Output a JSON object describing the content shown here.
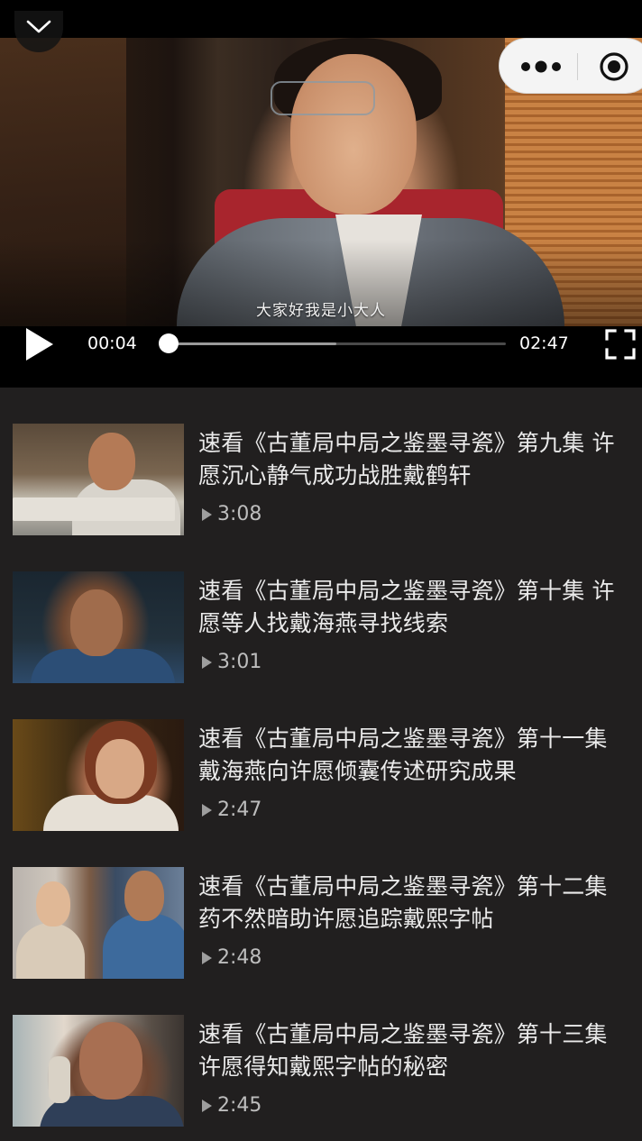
{
  "player": {
    "subtitle": "大家好我是小大人",
    "current_time": "00:04",
    "total_time": "02:47",
    "progress_fraction": 0.024,
    "buffered_fraction": 0.51
  },
  "icons": {
    "collapse": "chevron-down-icon",
    "more": "more-dots-icon",
    "close": "target-circle-icon",
    "play": "play-icon",
    "fullscreen": "fullscreen-icon",
    "duration": "play-triangle-icon"
  },
  "colors": {
    "background": "#211f1f",
    "title_text": "#eaeaea",
    "meta_text": "#bdbdbd",
    "player_bg": "#000000"
  },
  "episodes": [
    {
      "title": "速看《古董局中局之鉴墨寻瓷》第九集 许愿沉心静气成功战胜戴鹤轩",
      "duration": "3:08"
    },
    {
      "title": "速看《古董局中局之鉴墨寻瓷》第十集 许愿等人找戴海燕寻找线索",
      "duration": "3:01"
    },
    {
      "title": "速看《古董局中局之鉴墨寻瓷》第十一集 戴海燕向许愿倾囊传述研究成果",
      "duration": "2:47"
    },
    {
      "title": "速看《古董局中局之鉴墨寻瓷》第十二集 药不然暗助许愿追踪戴熙字帖",
      "duration": "2:48"
    },
    {
      "title": "速看《古董局中局之鉴墨寻瓷》第十三集 许愿得知戴熙字帖的秘密",
      "duration": "2:45"
    }
  ]
}
